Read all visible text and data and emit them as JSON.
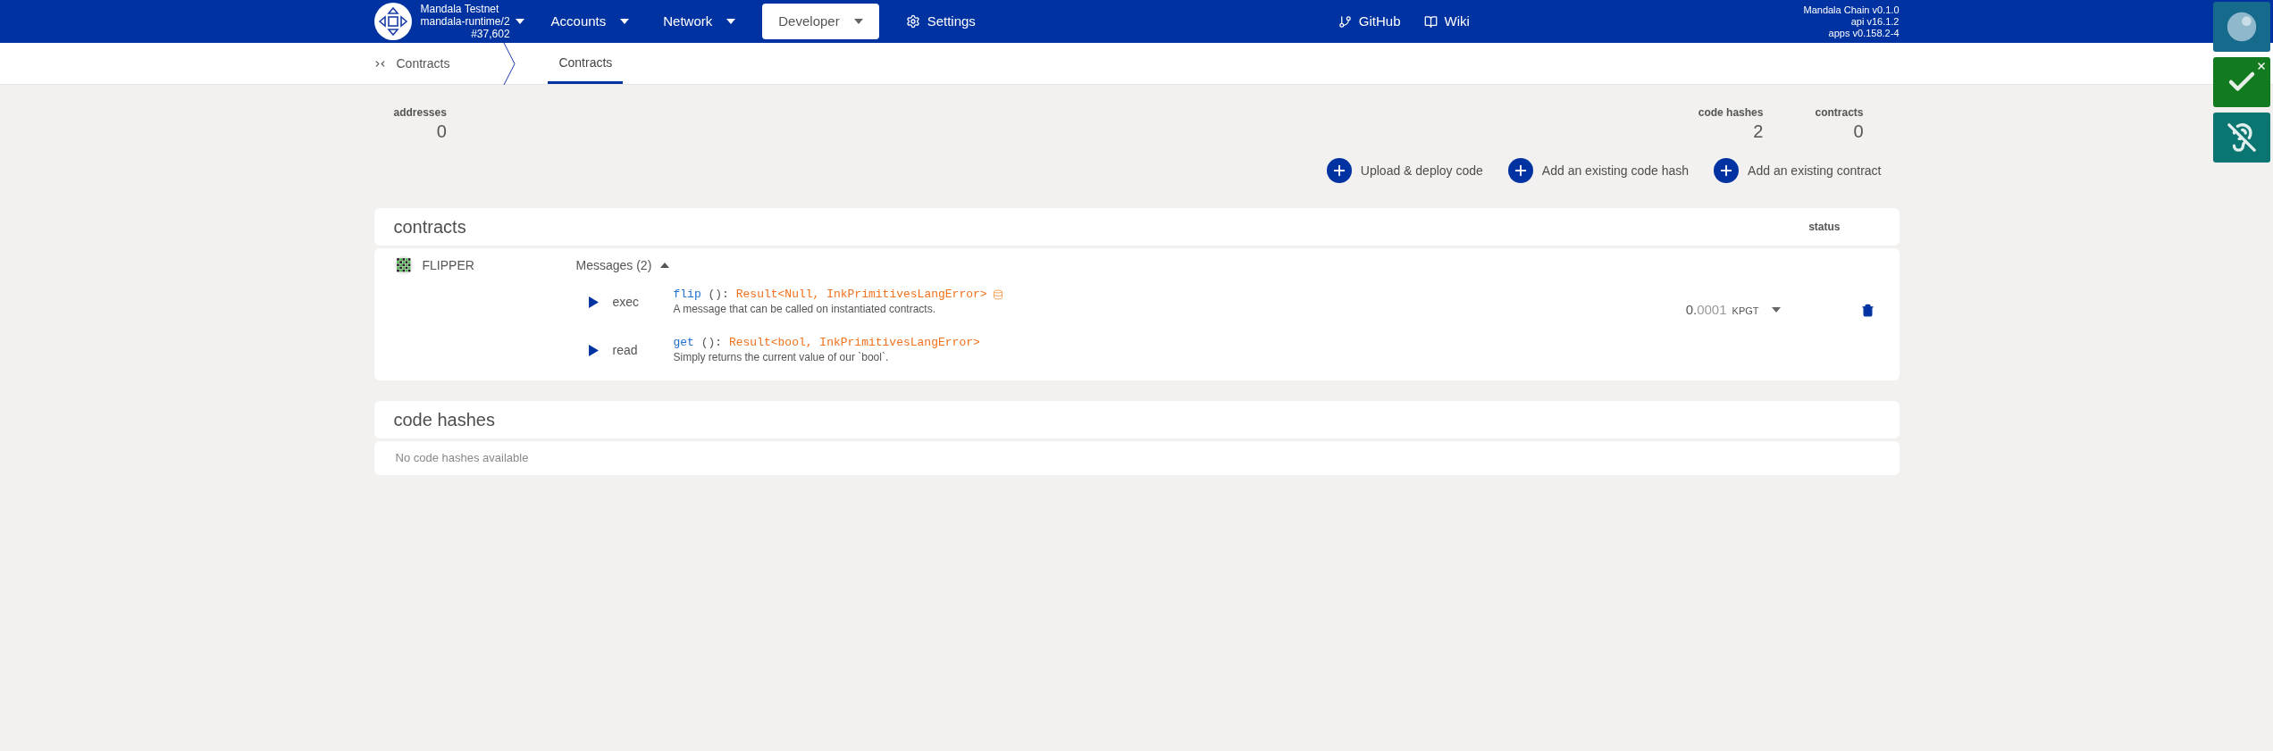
{
  "header": {
    "chain": {
      "name": "Mandala Testnet",
      "runtime": "mandala-runtime/2",
      "block": "#37,602"
    },
    "nav": [
      {
        "label": "Accounts",
        "kind": "menu",
        "selected": false
      },
      {
        "label": "Network",
        "kind": "menu",
        "selected": false
      },
      {
        "label": "Developer",
        "kind": "menu",
        "selected": true
      },
      {
        "label": "Settings",
        "kind": "settings",
        "selected": false
      }
    ],
    "links": [
      {
        "label": "GitHub",
        "kind": "github"
      },
      {
        "label": "Wiki",
        "kind": "wiki"
      }
    ],
    "versions": [
      "Mandala Chain v0.1.0",
      "api v16.1.2",
      "apps v0.158.2-4"
    ]
  },
  "subnav": {
    "section": "Contracts",
    "tabs": [
      {
        "label": "Contracts",
        "selected": true
      }
    ]
  },
  "stats_left": [
    {
      "label": "addresses",
      "value": "0"
    }
  ],
  "stats_right": [
    {
      "label": "code hashes",
      "value": "2"
    },
    {
      "label": "contracts",
      "value": "0"
    }
  ],
  "actions": [
    "Upload & deploy code",
    "Add an existing code hash",
    "Add an existing contract"
  ],
  "contracts": {
    "title": "contracts",
    "status_header": "status",
    "rows": [
      {
        "name": "FLIPPER",
        "messages_label": "Messages (2)",
        "expanded": true,
        "messages": [
          {
            "action": "exec",
            "name": "flip",
            "params": " ():",
            "return_type": "Result<Null, InkPrimitivesLangError>",
            "mutates": true,
            "doc": "A message that can be called on instantiated contracts."
          },
          {
            "action": "read",
            "name": "get",
            "params": " ():",
            "return_type": "Result<bool, InkPrimitivesLangError>",
            "mutates": false,
            "doc": "Simply returns the current value of our `bool`."
          }
        ],
        "balance": {
          "integer": "0.",
          "fraction": "0001",
          "unit": "KPGT"
        }
      }
    ]
  },
  "code_hashes": {
    "title": "code hashes",
    "empty_text": "No code hashes available"
  },
  "side_buttons": [
    {
      "kind": "bubble"
    },
    {
      "kind": "check"
    },
    {
      "kind": "ear"
    }
  ]
}
